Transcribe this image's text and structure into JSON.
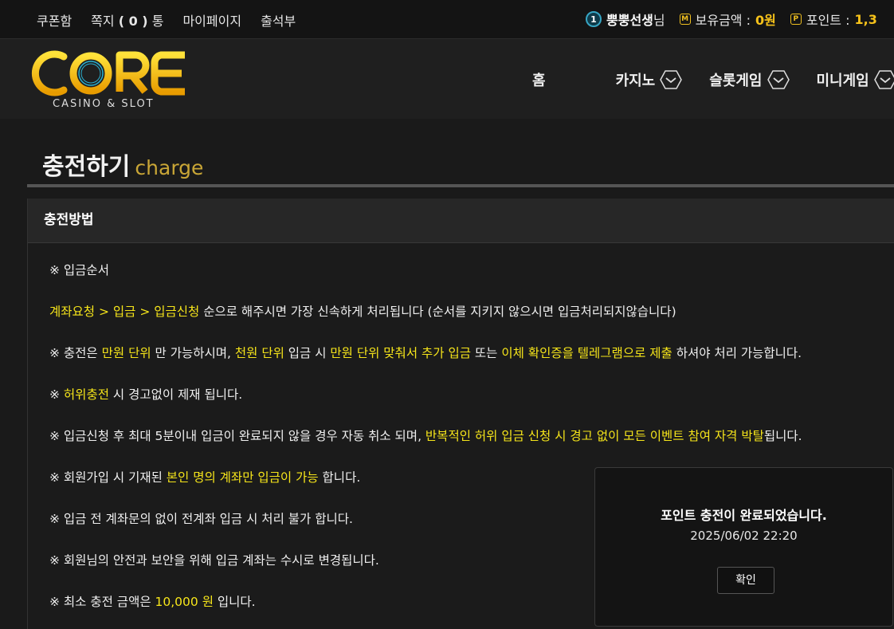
{
  "topbar": {
    "coupon": "쿠폰함",
    "messages_prefix": "쪽지",
    "messages_count": "( 0 )",
    "messages_suffix": "통",
    "mypage": "마이페이지",
    "attendance": "출석부",
    "level": "1",
    "username": "뿡뿡선생",
    "honorific": "님",
    "money_label": "보유금액 : ",
    "money_value": "0원",
    "point_label": "포인트 : ",
    "point_value": "1,3"
  },
  "header": {
    "logo_word": "CORE",
    "logo_sub": "CASINO & SLOT",
    "nav": [
      "홈",
      "카지노",
      "슬롯게임",
      "미니게임"
    ]
  },
  "page": {
    "title": "충전하기",
    "title_en": "charge"
  },
  "panel": {
    "heading": "충전방법",
    "order_title": "※ 입금순서",
    "order_hl": "계좌요청 > 입금 > 입금신청",
    "order_text": " 순으로 해주시면 가장 신속하게 처리됩니다 (순서를 지키지 않으시면 입금처리되지않습니다)",
    "r1": [
      "※ 충전은 ",
      "만원 단위",
      " 만 가능하시며, ",
      "천원 단위",
      " 입금 시 ",
      "만원 단위 맞춰서 추가 입금",
      " 또는 ",
      "이체 확인증을 텔레그램으로 제출",
      " 하셔야 처리 가능합니다."
    ],
    "r2": [
      "※ ",
      "허위충전",
      " 시 경고없이 제재 됩니다."
    ],
    "r3": [
      "※ 입금신청 후 최대 5분이내 입금이 완료되지 않을 경우 자동 취소 되며, ",
      "반복적인 허위 입금 신청 시 경고 없이 모든 이벤트 참여 자격 박탈",
      "됩니다."
    ],
    "r4": [
      "※ 회원가입 시 기재된 ",
      "본인 명의 계좌만 입금이 가능",
      " 합니다."
    ],
    "r5": "※ 입금 전 계좌문의 없이 전계좌 입금 시 처리 불가 합니다.",
    "r6": "※ 회원님의 안전과 보안을 위해 입금 계좌는 수시로 변경됩니다.",
    "r7": [
      "※ 최소 충전 금액은 ",
      "10,000 원",
      " 입니다."
    ]
  },
  "popup": {
    "message": "포인트 충전이 완료되었습니다.",
    "time": "2025/06/02 22:20",
    "confirm": "확인"
  },
  "colors": {
    "highlight": "#f6e51a",
    "gold": "#f6c21a",
    "level_ring": "#37a6c4"
  }
}
